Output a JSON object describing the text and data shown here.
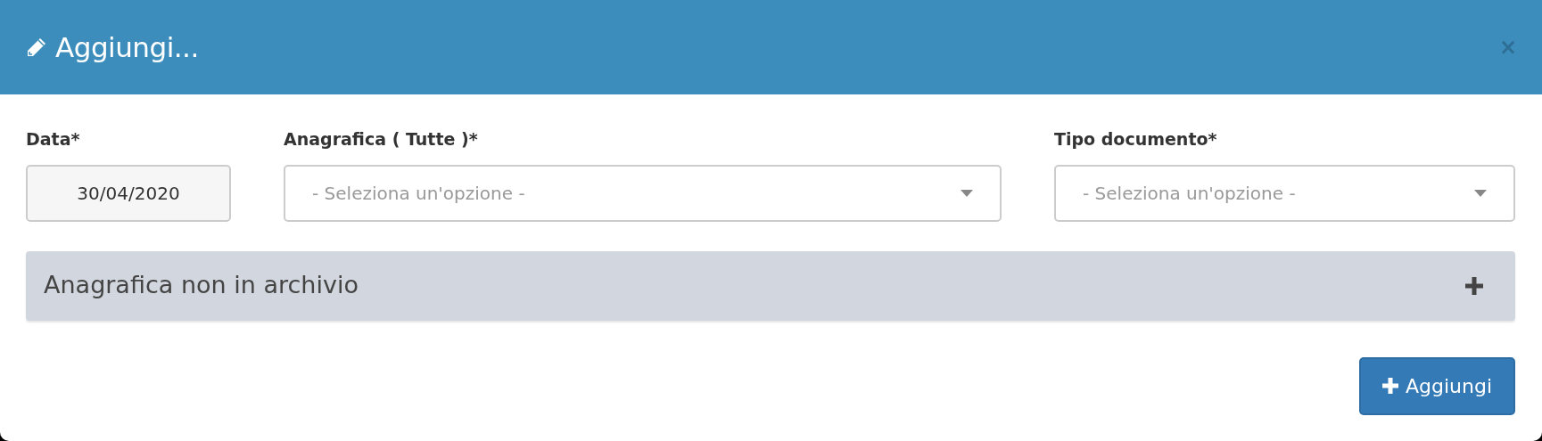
{
  "modal": {
    "title": "Aggiungi...",
    "close": "×"
  },
  "fields": [
    {
      "kind": "date",
      "label": "Data*",
      "value": "30/04/2020"
    },
    {
      "kind": "select",
      "label": "Anagrafica ( Tutte )*",
      "placeholder": "- Seleziona un'opzione -"
    },
    {
      "kind": "select",
      "label": "Tipo documento*",
      "placeholder": "- Seleziona un'opzione -"
    }
  ],
  "panel": {
    "title": "Anagrafica non in archivio",
    "expanded": false
  },
  "buttons": [
    {
      "label": "Aggiungi"
    }
  ]
}
